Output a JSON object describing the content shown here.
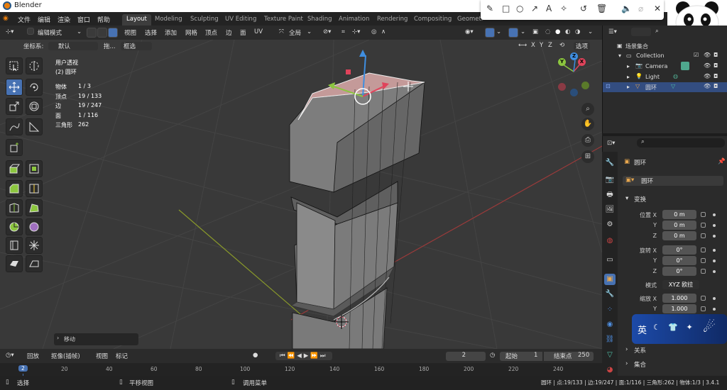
{
  "window": {
    "title": "Blender"
  },
  "menu": {
    "items": [
      "文件",
      "编辑",
      "渲染",
      "窗口",
      "帮助"
    ]
  },
  "workspaces": [
    {
      "label": "Layout",
      "active": true
    },
    {
      "label": "Modeling"
    },
    {
      "label": "Sculpting"
    },
    {
      "label": "UV Editing"
    },
    {
      "label": "Texture Paint"
    },
    {
      "label": "Shading"
    },
    {
      "label": "Animation"
    },
    {
      "label": "Rendering"
    },
    {
      "label": "Compositing"
    },
    {
      "label": "Geometr"
    }
  ],
  "viewport_header": {
    "mode": "编辑模式",
    "menus": [
      "视图",
      "选择",
      "添加",
      "网格",
      "顶点",
      "边",
      "面",
      "UV"
    ],
    "transform_orientation": "全局"
  },
  "viewport_header2": {
    "coord_label": "坐标系:",
    "coord_value": "默认",
    "drag_label": "拖...",
    "select_mode": "框选",
    "axes": [
      "X",
      "Y",
      "Z"
    ],
    "options": "选项"
  },
  "viewport_info": {
    "view_name": "用户透视",
    "object_name": "(2) 圆环"
  },
  "stats": [
    {
      "label": "物体",
      "value": "1 / 3"
    },
    {
      "label": "顶点",
      "value": "19 / 133"
    },
    {
      "label": "边",
      "value": "19 / 247"
    },
    {
      "label": "面",
      "value": "1 / 116"
    },
    {
      "label": "三角形",
      "value": "262"
    }
  ],
  "gizmo": {
    "x": "X",
    "y": "Y",
    "z": "Z"
  },
  "last_operator": "移动",
  "timeline": {
    "playback": "回放",
    "keying": "抠像(插帧)",
    "view": "视图",
    "marker": "标记",
    "current_frame": "2",
    "start_label": "起始",
    "start": "1",
    "end_label": "结束点",
    "end": "250",
    "frame_badge": "2",
    "ticks": [
      "20",
      "40",
      "60",
      "80",
      "100",
      "120",
      "140",
      "160",
      "180",
      "200",
      "220",
      "240"
    ]
  },
  "statusbar": {
    "select": "选择",
    "pan": "平移视图",
    "menu": "调用菜单",
    "stats": "圆环 | 点:19/133 | 边:19/247 | 面:1/116 | 三角形:262 | 物体:1/3 | 3.4.1"
  },
  "outliner": {
    "root": "场景集合",
    "collection": "Collection",
    "items": [
      {
        "name": "Camera"
      },
      {
        "name": "Light"
      },
      {
        "name": "圆环",
        "selected": true
      }
    ]
  },
  "properties": {
    "object_name": "圆环",
    "data_name": "圆环",
    "transform_label": "变换",
    "location_label": "位置 X",
    "rotation_label": "旋转 X",
    "scale_label": "缩放 X",
    "y": "Y",
    "z": "Z",
    "location": [
      "0 m",
      "0 m",
      "0 m"
    ],
    "rotation": [
      "0°",
      "0°",
      "0°"
    ],
    "mode_label": "模式",
    "mode_value": "XYZ 欧拉",
    "scale": [
      "1.000",
      "1.000"
    ],
    "relations": "关系",
    "collections": "集合"
  },
  "ime": {
    "label": "英"
  },
  "colors": {
    "accent": "#4772b3",
    "x_axis": "#e0435b",
    "y_axis": "#8cc63f",
    "z_axis": "#3f8ee0",
    "orange": "#e87d0d"
  }
}
